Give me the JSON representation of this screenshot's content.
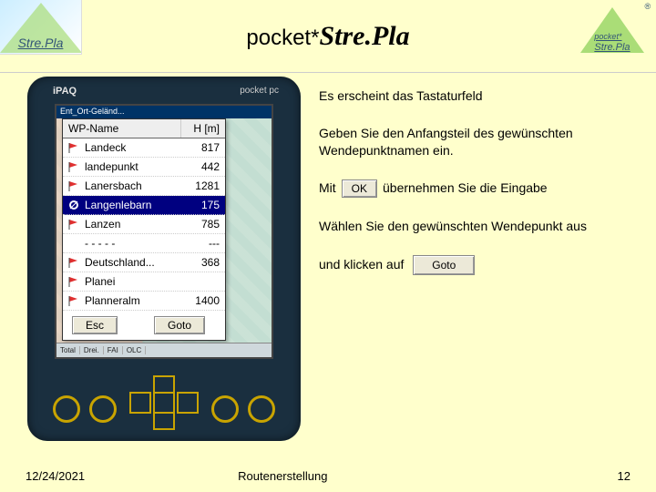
{
  "header": {
    "title_prefix": "pocket*",
    "title_main": "Stre.Pla",
    "logo_left_text": "Stre.Pla",
    "logo_right_small": "pocket*",
    "logo_right_text": "Stre.Pla",
    "trademark": "®"
  },
  "device": {
    "brand": "iPAQ",
    "platform": "pocket pc",
    "screen_title": "Ent_Ort-Geländ...",
    "tab_items": [
      "Total",
      "Drei.",
      "FAI",
      "OLC"
    ]
  },
  "wp_window": {
    "col_name": "WP-Name",
    "col_h": "H [m]",
    "rows": [
      {
        "icon": "flag",
        "name": "Landeck",
        "h": "817",
        "selected": false
      },
      {
        "icon": "flag",
        "name": "landepunkt",
        "h": "442",
        "selected": false
      },
      {
        "icon": "flag",
        "name": "Lanersbach",
        "h": "1281",
        "selected": false
      },
      {
        "icon": "circle",
        "name": "Langenlebarn",
        "h": "175",
        "selected": true
      },
      {
        "icon": "flag",
        "name": "Lanzen",
        "h": "785",
        "selected": false
      },
      {
        "icon": "none",
        "name": "- - - - -",
        "h": "---",
        "selected": false
      },
      {
        "icon": "flag",
        "name": "Deutschland...",
        "h": "368",
        "selected": false
      },
      {
        "icon": "flag",
        "name": "Planei",
        "h": "",
        "selected": false
      },
      {
        "icon": "flag",
        "name": "Planneralm",
        "h": "1400",
        "selected": false
      }
    ],
    "esc_label": "Esc",
    "goto_label": "Goto"
  },
  "instructions": {
    "p1": "Es erscheint das Tastaturfeld",
    "p2": "Geben Sie den Anfangsteil des gewünschten Wendepunktnamen ein.",
    "p3_a": "Mit",
    "p3_ok": "OK",
    "p3_b": "übernehmen Sie die Eingabe",
    "p4": "Wählen Sie den gewünschten Wendepunkt aus",
    "p5_a": "und klicken auf",
    "p5_goto": "Goto"
  },
  "footer": {
    "date": "12/24/2021",
    "section": "Routenerstellung",
    "page": "12"
  }
}
